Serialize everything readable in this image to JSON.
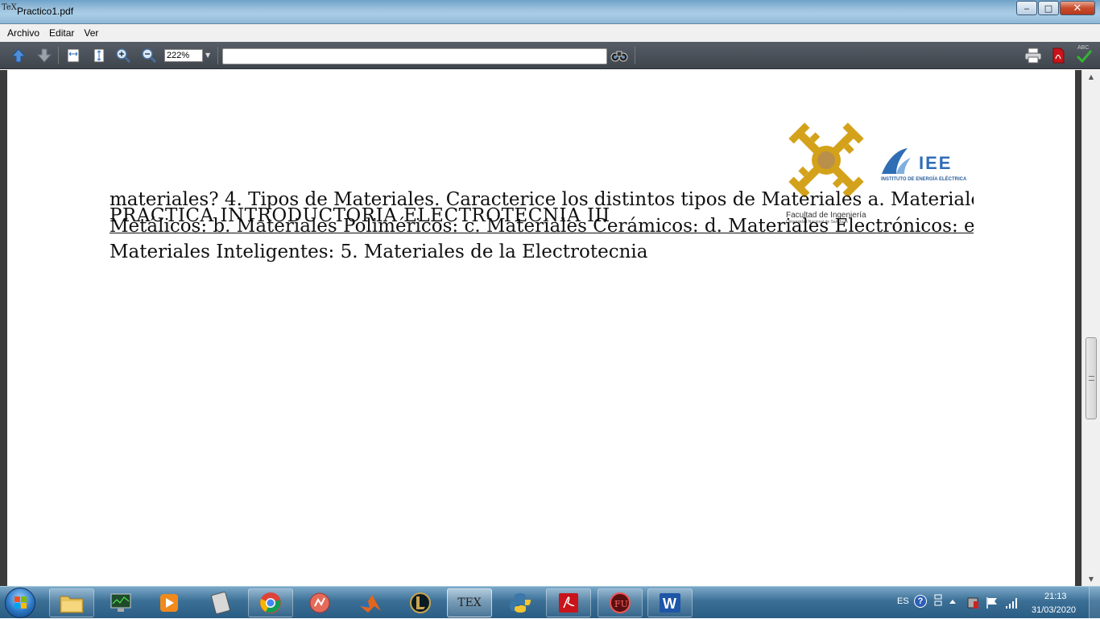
{
  "window": {
    "title": "Practico1.pdf",
    "app_icon_label": "TeX",
    "minimize_glyph": "‒",
    "maximize_glyph": "□",
    "close_glyph": "✕"
  },
  "menu": {
    "items": [
      "Archivo",
      "Editar",
      "Ver"
    ]
  },
  "toolbar": {
    "zoom_value": "222%",
    "zoom_arrow": "▼",
    "search_value": "",
    "spell_label": "ABC"
  },
  "document": {
    "line1": "materiales? 4. Tipos de Materiales. Caracterice los distintos tipos de Materiales a. Materiales",
    "heading": "PRACTICA INTRODUCTORIA ELECTROTECNIA III",
    "line2": "Metálicos: b. Materiales Poliméricos: c. Materiales Cerámicos: d. Materiales Electrónicos: e.",
    "line3": "Materiales Inteligentes: 5. Materiales de la Electrotecnia",
    "logo_fi_caption": "Facultad de Ingeniería",
    "logo_fi_sub": "Universidad Nacional de San Juan",
    "logo_iee_letters": "IEE",
    "logo_iee_caption": "INSTITUTO DE ENERGÍA ELÉCTRICA",
    "colors": {
      "fi_gold": "#d4a21a",
      "fi_center": "#b98f4a",
      "iee_blue": "#2f6db5"
    }
  },
  "scrollbar": {
    "up_glyph": "▲",
    "down_glyph": "▼"
  },
  "taskbar": {
    "language": "ES",
    "help_glyph": "?",
    "time": "21:13",
    "date": "31/03/2020",
    "tex_label": "TEX",
    "word_label": "W"
  }
}
